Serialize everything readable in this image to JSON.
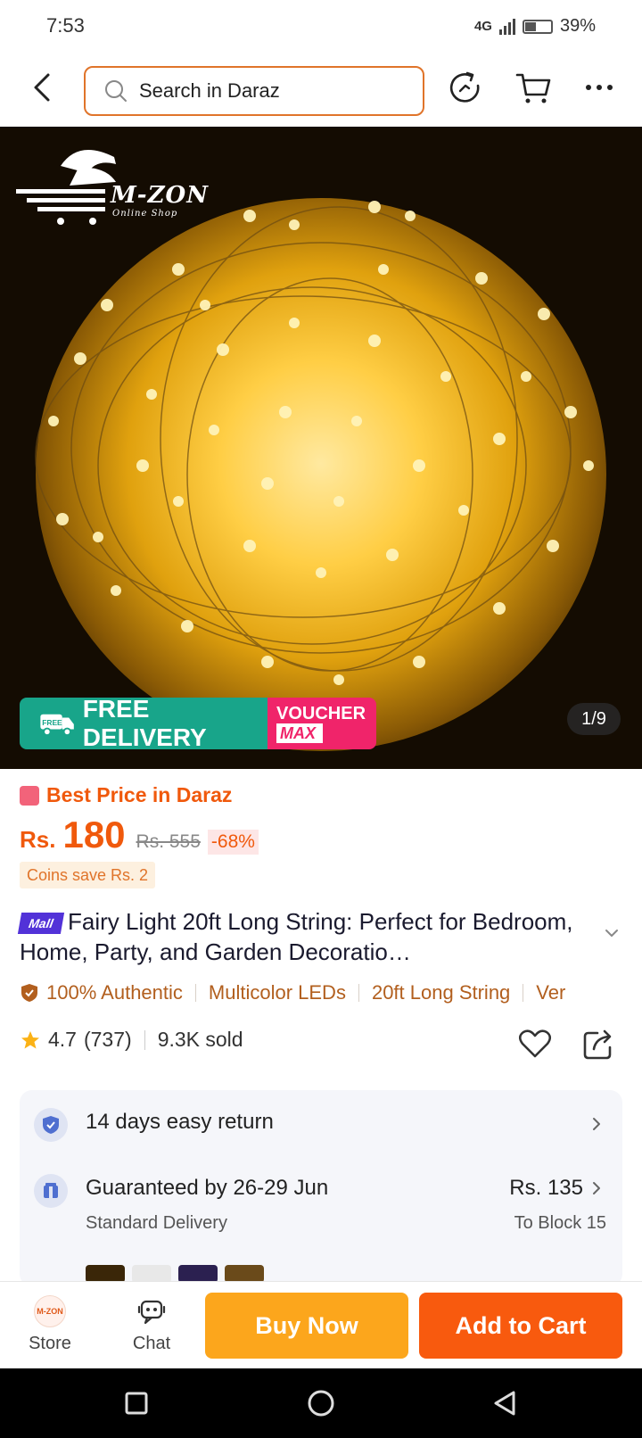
{
  "status_bar": {
    "time": "7:53",
    "network": "4G",
    "battery": "39%"
  },
  "header": {
    "search_placeholder": "Search in Daraz"
  },
  "gallery": {
    "logo_name": "M-ZON",
    "logo_sub": "Online Shop",
    "promo_badge": "FREE",
    "promo_free": "FREE DELIVERY",
    "promo_voucher_1": "VOUCHER",
    "promo_voucher_2": "MAX",
    "counter": "1/9"
  },
  "price": {
    "best_label": "Best Price in Daraz",
    "currency": "Rs.",
    "amount": "180",
    "original": "Rs. 555",
    "discount": "-68%",
    "coins": "Coins save Rs. 2"
  },
  "product": {
    "badge": "Mall",
    "title": "Fairy Light 20ft Long String: Perfect for Bedroom, Home, Party, and Garden Decoratio…"
  },
  "features": [
    "100% Authentic",
    "Multicolor LEDs",
    "20ft Long String",
    "Ver"
  ],
  "rating": {
    "score": "4.7",
    "count": "(737)",
    "sold": "9.3K sold"
  },
  "service": {
    "return_label": "14 days easy return",
    "guarantee": "Guaranteed by 26-29 Jun",
    "delivery_type": "Standard Delivery",
    "shipping_price": "Rs. 135",
    "ship_to": "To Block 15"
  },
  "bottom_bar": {
    "store_label": "Store",
    "chat_label": "Chat",
    "buy_now": "Buy Now",
    "add_to_cart": "Add to Cart"
  },
  "colors": {
    "accent": "#f85a0e",
    "buy_now": "#fca61c",
    "free_delivery": "#18a58a",
    "voucher": "#f0246a",
    "mall": "#5232d8"
  }
}
